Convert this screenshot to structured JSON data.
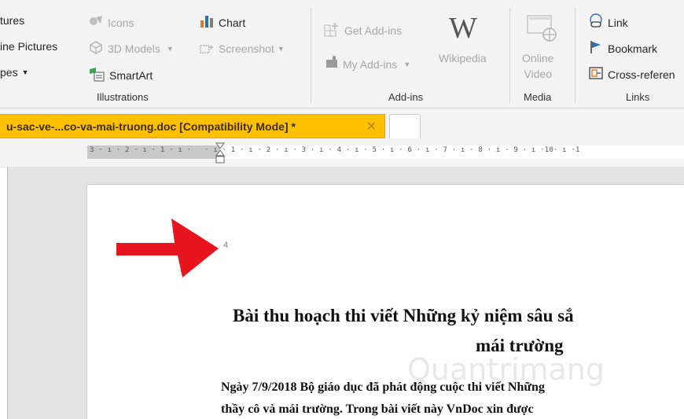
{
  "ribbon": {
    "illustrations": {
      "pictures": "tures",
      "online_pictures": "ine Pictures",
      "shapes": "pes",
      "icons": "Icons",
      "models_3d": "3D Models",
      "smartart": "SmartArt",
      "chart": "Chart",
      "screenshot": "Screenshot",
      "group_label": "Illustrations"
    },
    "addins": {
      "get_addins": "Get Add-ins",
      "my_addins": "My Add-ins",
      "wikipedia": "Wikipedia",
      "wikipedia_glyph": "W",
      "group_label": "Add-ins"
    },
    "media": {
      "online_video_line1": "Online",
      "online_video_line2": "Video",
      "group_label": "Media"
    },
    "links": {
      "link": "Link",
      "bookmark": "Bookmark",
      "cross_reference": "Cross-referen",
      "group_label": "Links"
    }
  },
  "tabs": {
    "document_tab": "u-sac-ve-...co-va-mai-truong.doc [Compatibility Mode] *",
    "close_glyph": "✕"
  },
  "ruler": {
    "text": "3 · ı · 2 · ı · 1 · ı ·   · ı · 1 · ı · 2 · ı · 3 · ı · 4 · ı · 5 · ı · 6 · ı · 7 · ı · 8 · ı · 9 · ı ·10· ı ·1"
  },
  "document": {
    "page_number": "4",
    "title_line1": "Bài thu hoạch thi viết Những kỷ niệm sâu sắ",
    "title_line2": "mái trường",
    "body_line1": "Ngày 7/9/2018 Bộ giáo dục đã phát động cuộc thi viết Những",
    "body_line2": "thầy cô và mái trường. Trong bài viết này VnDoc xin được",
    "watermark": "Quantrimang"
  },
  "colors": {
    "tab_active": "#ffc000",
    "arrow": "#e8141e"
  }
}
